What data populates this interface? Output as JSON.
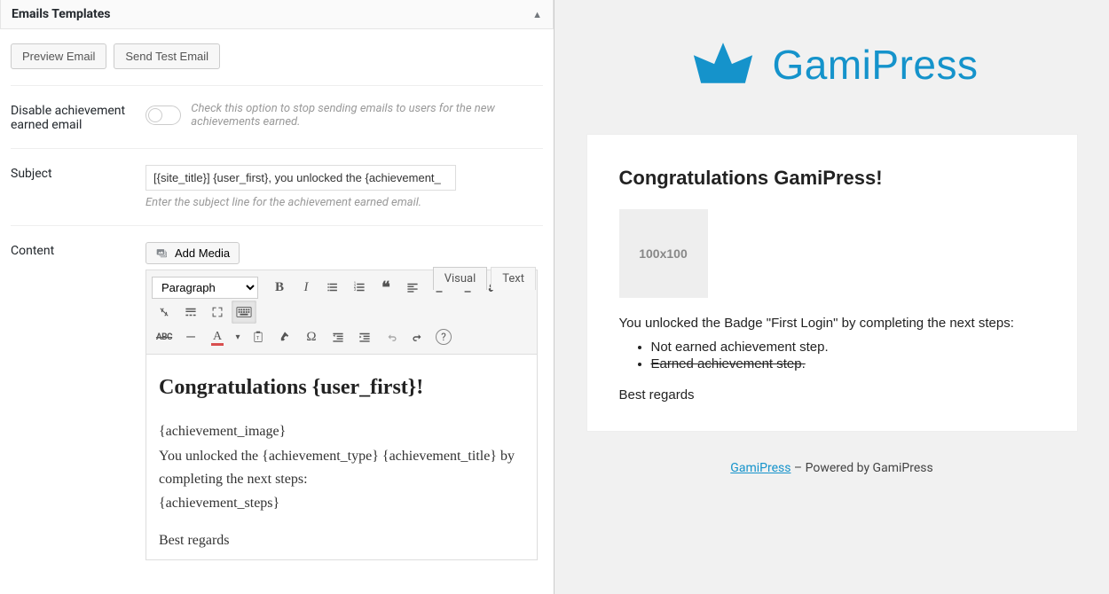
{
  "panel": {
    "title": "Emails Templates"
  },
  "actions": {
    "preview": "Preview Email",
    "send_test": "Send Test Email"
  },
  "toggle": {
    "label": "Disable achievement earned email",
    "hint": "Check this option to stop sending emails to users for the new achievements earned."
  },
  "subject": {
    "label": "Subject",
    "value": "[{site_title}] {user_first}, you unlocked the {achievement_",
    "hint": "Enter the subject line for the achievement earned email."
  },
  "content": {
    "label": "Content",
    "add_media": "Add Media",
    "tabs": {
      "visual": "Visual",
      "text": "Text"
    },
    "paragraph": "Paragraph",
    "heading": "Congratulations {user_first}!",
    "line1": "{achievement_image}",
    "line2": "You unlocked the {achievement_type} {achievement_title} by completing the next steps:",
    "line3": "{achievement_steps}",
    "line4": "Best regards"
  },
  "tb": {
    "bold": "B",
    "italic": "I",
    "quote": "❝",
    "strike": "ABC",
    "hr": "—",
    "text_color_a": "A",
    "special": "Ω",
    "help": "?"
  },
  "preview": {
    "brand": "GamiPress",
    "heading": "Congratulations GamiPress!",
    "placeholder": "100x100",
    "intro": "You unlocked the Badge \"First Login\" by completing the next steps:",
    "step1": "Not earned achievement step.",
    "step2": "Earned achievement step.",
    "regards": "Best regards",
    "footer_link": "GamiPress",
    "footer_rest": " – Powered by GamiPress"
  }
}
